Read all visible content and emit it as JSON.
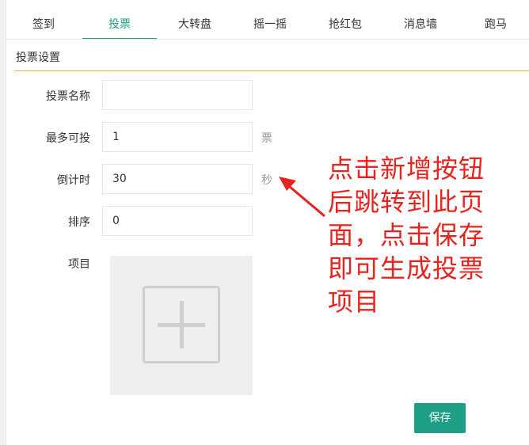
{
  "tabs": [
    {
      "label": "签到"
    },
    {
      "label": "投票"
    },
    {
      "label": "大转盘"
    },
    {
      "label": "摇一摇"
    },
    {
      "label": "抢红包"
    },
    {
      "label": "消息墙"
    },
    {
      "label": "跑马"
    }
  ],
  "active_tab": "投票",
  "section": {
    "title": "投票设置"
  },
  "form": {
    "name": {
      "label": "投票名称",
      "value": ""
    },
    "max_votes": {
      "label": "最多可投",
      "value": "1",
      "unit": "票"
    },
    "countdown": {
      "label": "倒计时",
      "value": "30",
      "unit": "秒"
    },
    "sort": {
      "label": "排序",
      "value": "0"
    },
    "items": {
      "label": "项目"
    }
  },
  "save_label": "保存",
  "annotation": {
    "text": "点击新增按钮后跳转到此页面，点击保存即可生成投票项目"
  },
  "colors": {
    "accent": "#1e9e84",
    "annotation": "#e8221c",
    "divider": "#e8b84a"
  }
}
